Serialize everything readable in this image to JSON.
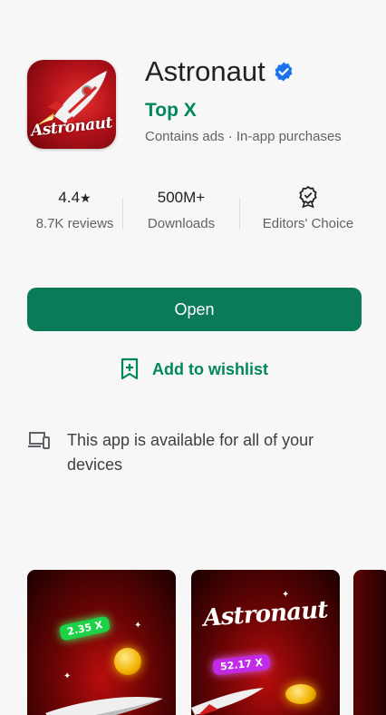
{
  "app": {
    "title": "Astronaut",
    "icon_text": "Astronaut",
    "developer": "Top X",
    "ads_info": "Contains ads · In-app purchases",
    "verified_icon": "verified-badge-icon",
    "brand_color": "#01875f"
  },
  "stats": {
    "rating_value": "4.4",
    "rating_star": "★",
    "rating_label": "8.7K reviews",
    "downloads_value": "500M+",
    "downloads_label": "Downloads",
    "editors_icon": "editors-choice-icon",
    "editors_label": "Editors' Choice"
  },
  "actions": {
    "open_label": "Open",
    "wishlist_label": "Add to wishlist",
    "wishlist_icon": "bookmark-add-icon"
  },
  "devices": {
    "icon": "devices-icon",
    "text": "This app is available for all of your devices"
  },
  "screenshots": {
    "shot1_multiplier": "2.35 X",
    "shot2_logo": "Astronaut",
    "shot2_multiplier": "52.17 X"
  }
}
